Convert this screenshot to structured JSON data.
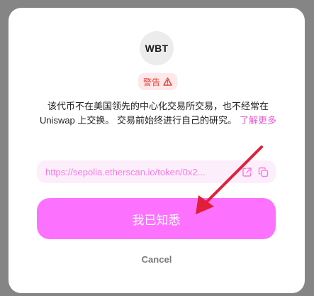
{
  "token": {
    "symbol": "WBT"
  },
  "warning": {
    "label": "警告",
    "icon": "warning-triangle-icon",
    "color": "#e0463f"
  },
  "description": {
    "text": "该代币不在美国领先的中心化交易所交易，也不经常在 Uniswap 上交换。 交易前始终进行自己的研究。",
    "learn_more": "了解更多"
  },
  "etherscan": {
    "url": "https://sepolia.etherscan.io/token/0x2...",
    "icons": [
      "external-link-icon",
      "copy-icon"
    ]
  },
  "actions": {
    "confirm_label": "我已知悉",
    "cancel_label": "Cancel"
  },
  "colors": {
    "accent": "#fc72ff",
    "link": "#f57ae8",
    "backdrop": "#858585",
    "annotation_arrow": "#e0203a"
  }
}
